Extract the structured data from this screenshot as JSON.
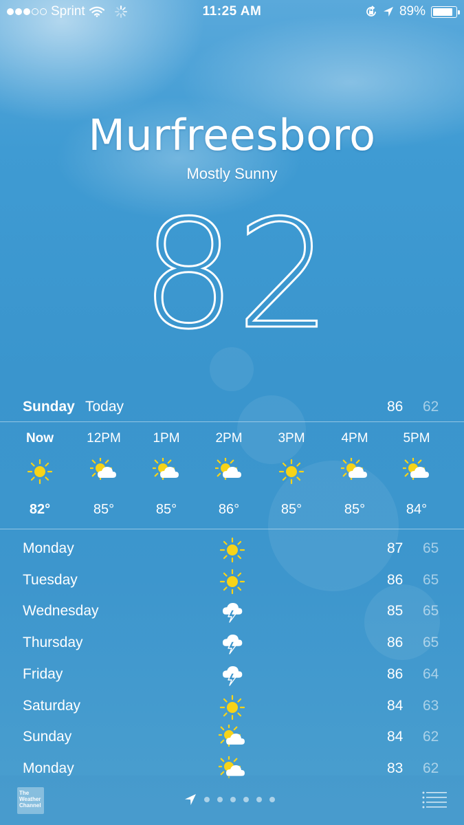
{
  "status_bar": {
    "carrier": "Sprint",
    "time": "11:25 AM",
    "battery": "89%",
    "battery_level": 0.89,
    "signal_filled": 3,
    "signal_total": 5
  },
  "location": {
    "city": "Murfreesboro",
    "condition": "Mostly Sunny",
    "temperature": "82°"
  },
  "today": {
    "day": "Sunday",
    "label": "Today",
    "high": "86",
    "low": "62"
  },
  "hourly": [
    {
      "time": "Now",
      "icon": "sun-icon",
      "temp": "82°"
    },
    {
      "time": "12PM",
      "icon": "partly-cloudy-icon",
      "temp": "85°"
    },
    {
      "time": "1PM",
      "icon": "partly-cloudy-icon",
      "temp": "85°"
    },
    {
      "time": "2PM",
      "icon": "partly-cloudy-icon",
      "temp": "86°"
    },
    {
      "time": "3PM",
      "icon": "sun-icon",
      "temp": "85°"
    },
    {
      "time": "4PM",
      "icon": "partly-cloudy-icon",
      "temp": "85°"
    },
    {
      "time": "5PM",
      "icon": "partly-cloudy-icon",
      "temp": "84°"
    }
  ],
  "daily": [
    {
      "day": "Monday",
      "icon": "sun-icon",
      "high": "87",
      "low": "65"
    },
    {
      "day": "Tuesday",
      "icon": "sun-icon",
      "high": "86",
      "low": "65"
    },
    {
      "day": "Wednesday",
      "icon": "thunderstorm-icon",
      "high": "85",
      "low": "65"
    },
    {
      "day": "Thursday",
      "icon": "thunderstorm-icon",
      "high": "86",
      "low": "65"
    },
    {
      "day": "Friday",
      "icon": "thunderstorm-icon",
      "high": "86",
      "low": "64"
    },
    {
      "day": "Saturday",
      "icon": "sun-icon",
      "high": "84",
      "low": "63"
    },
    {
      "day": "Sunday",
      "icon": "partly-cloudy-icon",
      "high": "84",
      "low": "62"
    },
    {
      "day": "Monday",
      "icon": "partly-cloudy-icon",
      "high": "83",
      "low": "62"
    }
  ],
  "bottom_bar": {
    "logo_text": "The Weather Channel",
    "page_count": 6
  },
  "colors": {
    "sun": "#f7d318",
    "cloud": "#ffffff",
    "background_top": "#5aa9db",
    "background_bottom": "#4b9fcf"
  }
}
